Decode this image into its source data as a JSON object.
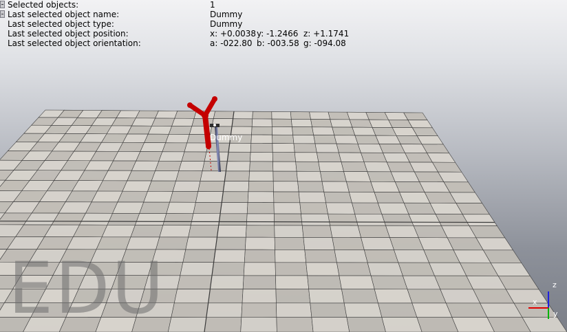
{
  "info": {
    "rows": [
      {
        "label": "Selected objects:",
        "value": "1"
      },
      {
        "label": "Last selected object name:",
        "value": "Dummy"
      },
      {
        "label": "Last selected object type:",
        "value": "Dummy"
      },
      {
        "label": "Last selected object position:",
        "x": "x: +0.0038",
        "y": "y: -1.2466",
        "z": "z: +1.1741"
      },
      {
        "label": "Last selected object orientation:",
        "a": "a: -022.80",
        "b": "b: -003.58",
        "g": "g: -094.08"
      }
    ]
  },
  "scene": {
    "object_label": "Dummy",
    "watermark": "EDU",
    "floor_colors": {
      "light": "#d9d5ce",
      "dark": "#c3bfb8",
      "grid": "#3b3b3b"
    },
    "robot_color": "#c40000"
  },
  "axes": {
    "x_label": "x",
    "y_label": "y",
    "z_label": "z",
    "x_color": "#e00000",
    "y_color": "#00b400",
    "z_color": "#2020e0"
  }
}
